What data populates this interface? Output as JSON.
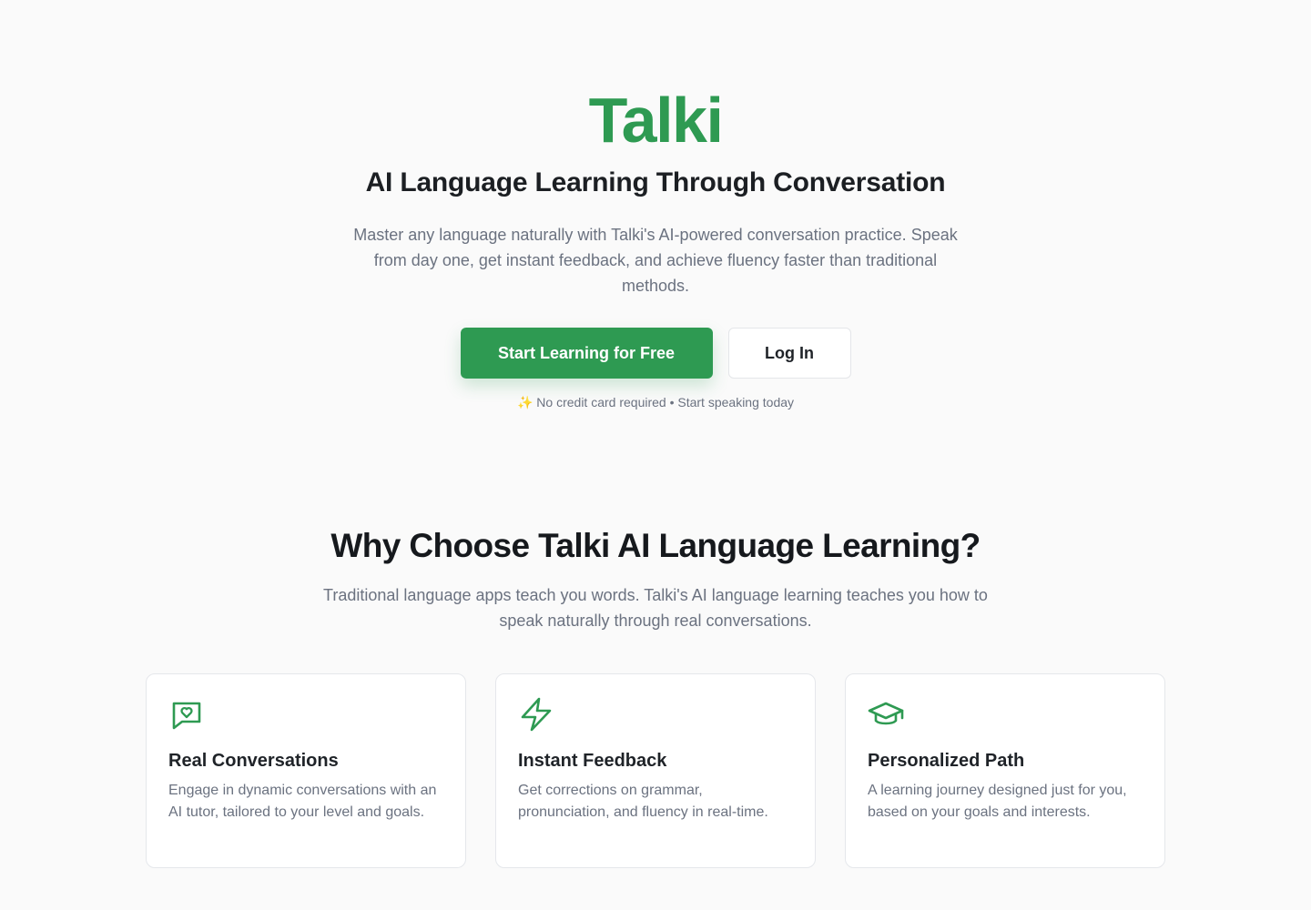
{
  "brand": {
    "name": "Talki",
    "accent_color": "#2e9a52"
  },
  "hero": {
    "title": "AI Language Learning Through Conversation",
    "description": "Master any language naturally with Talki's AI-powered conversation practice. Speak from day one, get instant feedback, and achieve fluency faster than traditional methods.",
    "primary_cta": "Start Learning for Free",
    "secondary_cta": "Log In",
    "note_icon": "sparkles-icon",
    "note_glyph": "✨",
    "note": "No credit card required • Start speaking today"
  },
  "why": {
    "title": "Why Choose Talki AI Language Learning?",
    "description": "Traditional language apps teach you words. Talki's AI language learning teaches you how to speak naturally through real conversations."
  },
  "features": [
    {
      "icon": "message-heart-icon",
      "title": "Real Conversations",
      "description": "Engage in dynamic conversations with an AI tutor, tailored to your level and goals."
    },
    {
      "icon": "lightning-bolt-icon",
      "title": "Instant Feedback",
      "description": "Get corrections on grammar, pronunciation, and fluency in real-time."
    },
    {
      "icon": "graduation-cap-icon",
      "title": "Personalized Path",
      "description": "A learning journey designed just for you, based on your goals and interests."
    }
  ]
}
